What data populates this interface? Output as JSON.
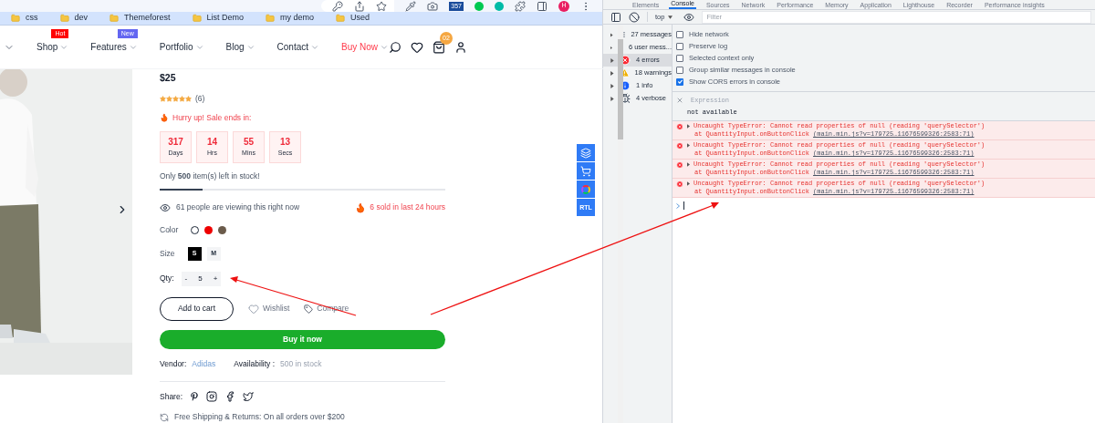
{
  "bookmarks": [
    "css",
    "dev",
    "Themeforest",
    "List Demo",
    "my demo",
    "Used"
  ],
  "profile_initial": "H",
  "extension_badge": "357",
  "nav": [
    {
      "label": "Shop",
      "badge": "Hot",
      "color": "#ff0000",
      "kind": "normal"
    },
    {
      "label": "Features",
      "badge": "New",
      "color": "#6366f1",
      "kind": "normal"
    },
    {
      "label": "Portfolio",
      "kind": "normal"
    },
    {
      "label": "Blog",
      "kind": "normal"
    },
    {
      "label": "Contact",
      "kind": "normal"
    },
    {
      "label": "Buy Now",
      "kind": "highlight"
    }
  ],
  "cart_count": "02",
  "product": {
    "price": "$25",
    "stars": 5,
    "reviews": "(6)",
    "hurry": "Hurry up! Sale ends in:",
    "countdown": [
      {
        "value": "317",
        "unit": "Days"
      },
      {
        "value": "14",
        "unit": "Hrs"
      },
      {
        "value": "55",
        "unit": "Mins"
      },
      {
        "value": "13",
        "unit": "Secs"
      }
    ],
    "stock_text": "Only **500** item(s) left in stock!",
    "stock_bar": {
      "level": 0.15
    },
    "viewing": "61 people are viewing this right now",
    "sold": "6 sold in last 24 hours",
    "color_label": "Color",
    "colors": [
      {
        "color": "#ffffff",
        "selected": true
      },
      {
        "color": "#ee0000",
        "selected": false
      },
      {
        "color": "#6b5b4b",
        "selected": false
      }
    ],
    "size_label": "Size",
    "sizes": [
      {
        "label": "S",
        "selected": true
      },
      {
        "label": "M",
        "selected": false
      }
    ],
    "qty_label": "Qty:",
    "qty_minus": "-",
    "qty": "5",
    "qty_plus": "+",
    "add_to_cart": "Add to cart",
    "wishlist": "Wishlist",
    "compare": "Compare",
    "buy_now": "Buy it now",
    "vendor_label": "Vendor:",
    "vendor": "Adidas",
    "availability_label": "Availability :",
    "availability": "500 in stock",
    "share_label": "Share:",
    "shipping": "Free Shipping & Returns: On all orders over $200"
  },
  "side_tools": [
    {
      "kind": "layers"
    },
    {
      "kind": "cart"
    },
    {
      "kind": "colors"
    },
    {
      "kind": "text",
      "label": "RTL"
    }
  ],
  "devtools": {
    "tabs": [
      {
        "label": "Elements",
        "selected": false
      },
      {
        "label": "Console",
        "selected": true
      },
      {
        "label": "Sources",
        "selected": false
      },
      {
        "label": "Network",
        "selected": false
      },
      {
        "label": "Performance",
        "selected": false
      },
      {
        "label": "Memory",
        "selected": false
      },
      {
        "label": "Application",
        "selected": false
      },
      {
        "label": "Lighthouse",
        "selected": false
      },
      {
        "label": "Recorder",
        "selected": false
      },
      {
        "label": "Performance insights",
        "selected": false
      }
    ],
    "context": "top",
    "filter_placeholder": "Filter",
    "sidebar": [
      {
        "label": "27 messages",
        "kind": "list",
        "selected": false
      },
      {
        "label": "6 user mess...",
        "kind": "user",
        "selected": false
      },
      {
        "label": "4 errors",
        "kind": "error",
        "selected": true
      },
      {
        "label": "18 warnings",
        "kind": "warning",
        "selected": false
      },
      {
        "label": "1 info",
        "kind": "info",
        "selected": false
      },
      {
        "label": "4 verbose",
        "kind": "verbose",
        "selected": false
      }
    ],
    "options": [
      {
        "label": "Hide network",
        "checked": false
      },
      {
        "label": "Preserve log",
        "checked": false
      },
      {
        "label": "Selected context only",
        "checked": false
      },
      {
        "label": "Group similar messages in console",
        "checked": false
      },
      {
        "label": "Show CORS errors in console",
        "checked": true
      }
    ],
    "expression": {
      "label": "Expression",
      "value": "not available"
    },
    "errors": [
      {
        "message": "Uncaught TypeError: Cannot read properties of null (reading 'querySelector')",
        "trace": "at QuantityInput.onButtonClick",
        "link": "(main.min.js?v=179725…11676599326:2583:71)"
      },
      {
        "message": "Uncaught TypeError: Cannot read properties of null (reading 'querySelector')",
        "trace": "at QuantityInput.onButtonClick",
        "link": "(main.min.js?v=179725…11676599326:2583:71)"
      },
      {
        "message": "Uncaught TypeError: Cannot read properties of null (reading 'querySelector')",
        "trace": "at QuantityInput.onButtonClick",
        "link": "(main.min.js?v=179725…11676599326:2583:71)"
      },
      {
        "message": "Uncaught TypeError: Cannot read properties of null (reading 'querySelector')",
        "trace": "at QuantityInput.onButtonClick",
        "link": "(main.min.js?v=179725…11676599326:2583:71)"
      }
    ]
  }
}
